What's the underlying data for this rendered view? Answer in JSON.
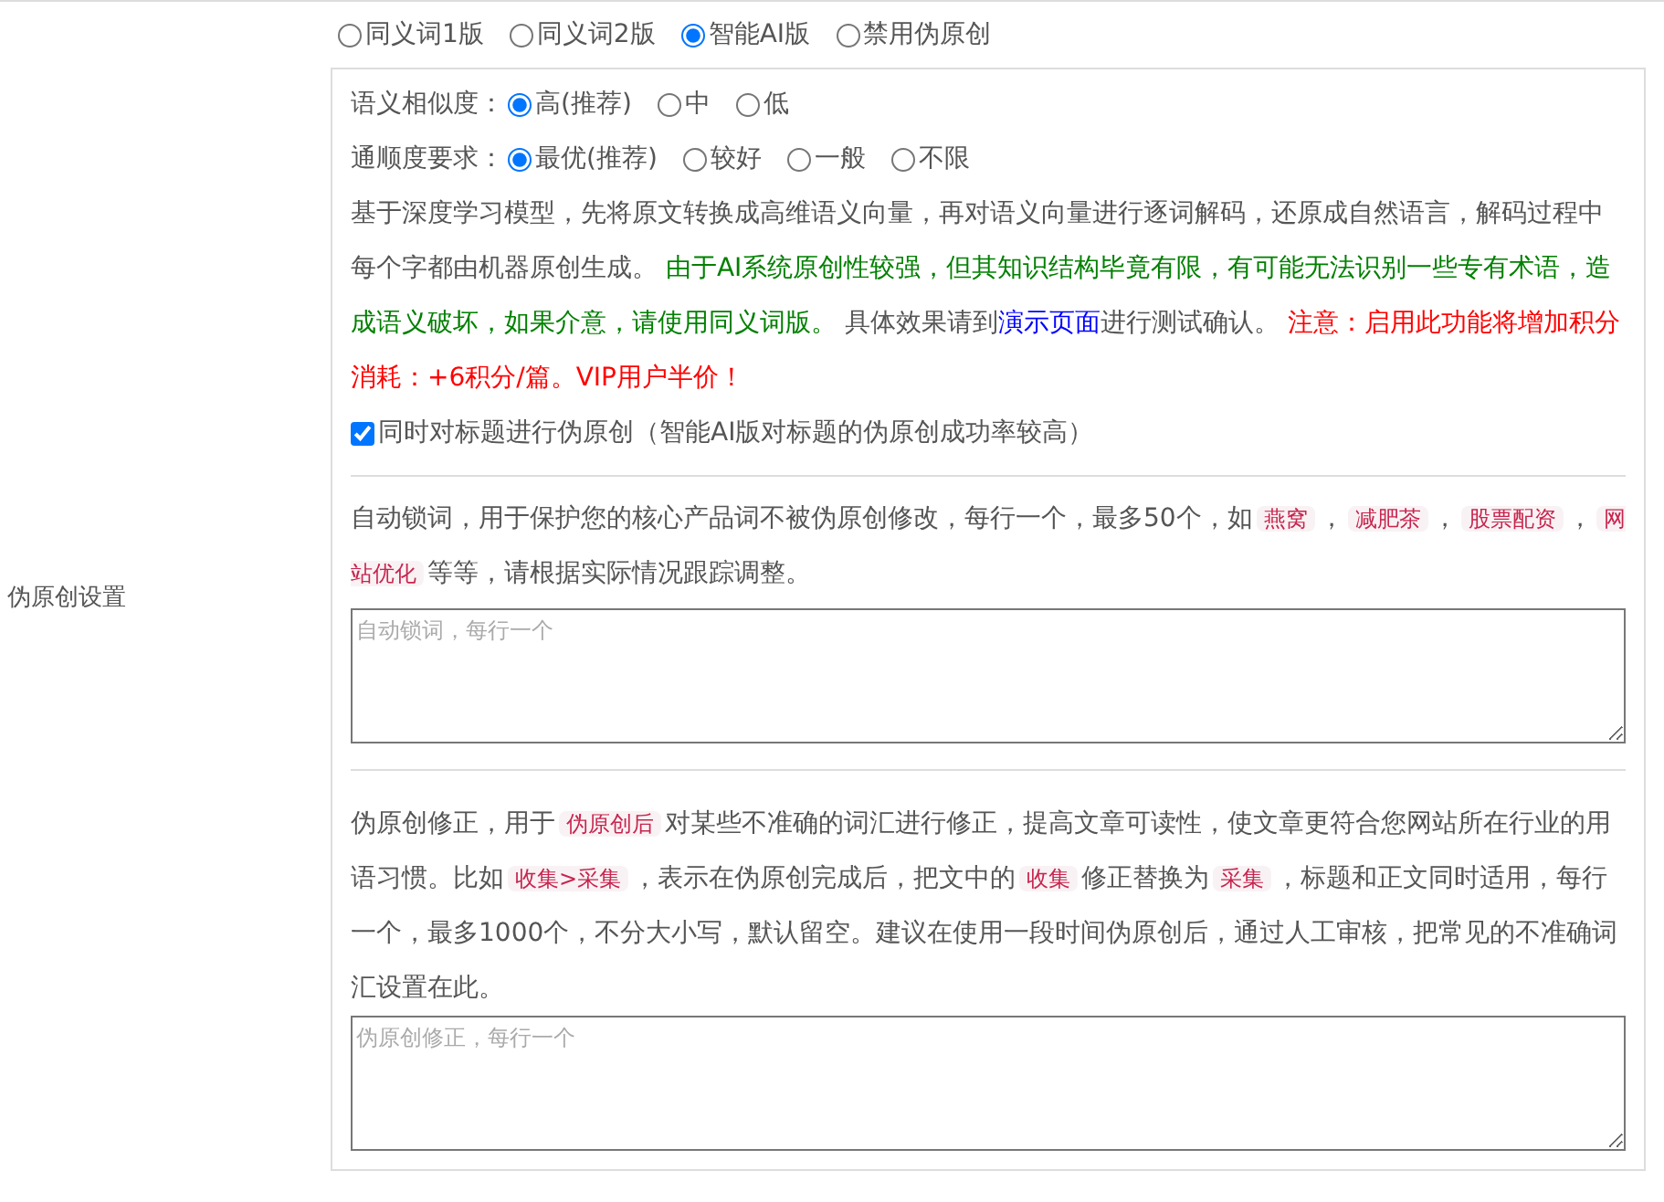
{
  "side_label": "伪原创设置",
  "modes": [
    {
      "label": "同义词1版",
      "selected": false
    },
    {
      "label": "同义词2版",
      "selected": false
    },
    {
      "label": "智能AI版",
      "selected": true
    },
    {
      "label": "禁用伪原创",
      "selected": false
    }
  ],
  "option_groups": [
    {
      "label": "语义相似度：",
      "options": [
        {
          "label": "高(推荐)",
          "selected": true
        },
        {
          "label": "中",
          "selected": false
        },
        {
          "label": "低",
          "selected": false
        }
      ]
    },
    {
      "label": "通顺度要求：",
      "options": [
        {
          "label": "最优(推荐)",
          "selected": true
        },
        {
          "label": "较好",
          "selected": false
        },
        {
          "label": "一般",
          "selected": false
        },
        {
          "label": "不限",
          "selected": false
        }
      ]
    }
  ],
  "ai_description": [
    {
      "kind": "plain",
      "text": "基于深度学习模型，先将原文转换成高维语义向量，再对语义向量进行逐词解码，还原成自然语言，解码过程中每个字都由机器原创生成。 "
    },
    {
      "kind": "green",
      "text": "由于AI系统原创性较强，但其知识结构毕竟有限，有可能无法识别一些专有术语，造成语义破坏，如果介意，请使用同义词版。"
    },
    {
      "kind": "plain",
      "text": " 具体效果请到"
    },
    {
      "kind": "link",
      "text": "演示页面"
    },
    {
      "kind": "plain",
      "text": "进行测试确认。 "
    },
    {
      "kind": "red",
      "text": "注意：启用此功能将增加积分消耗：+6积分/篇。VIP用户半价！"
    }
  ],
  "title_checkbox": {
    "label": "同时对标题进行伪原创（智能AI版对标题的伪原创成功率较高）",
    "checked": true
  },
  "lock_description": [
    {
      "kind": "plain",
      "text": "自动锁词，用于保护您的核心产品词不被伪原创修改，每行一个，最多50个，如"
    },
    {
      "kind": "code",
      "text": "燕窝"
    },
    {
      "kind": "plain",
      "text": "，"
    },
    {
      "kind": "code",
      "text": "减肥茶"
    },
    {
      "kind": "plain",
      "text": "，"
    },
    {
      "kind": "code",
      "text": "股票配资"
    },
    {
      "kind": "plain",
      "text": "，"
    },
    {
      "kind": "code",
      "text": "网站优化"
    },
    {
      "kind": "plain",
      "text": "等等，请根据实际情况跟踪调整。"
    }
  ],
  "lock_field": {
    "placeholder": "自动锁词，每行一个"
  },
  "fix_description": [
    {
      "kind": "plain",
      "text": "伪原创修正，用于"
    },
    {
      "kind": "code",
      "text": "伪原创后"
    },
    {
      "kind": "plain",
      "text": "对某些不准确的词汇进行修正，提高文章可读性，使文章更符合您网站所在行业的用语习惯。比如"
    },
    {
      "kind": "code",
      "text": "收集>采集"
    },
    {
      "kind": "plain",
      "text": "，表示在伪原创完成后，把文中的"
    },
    {
      "kind": "code",
      "text": "收集"
    },
    {
      "kind": "plain",
      "text": "修正替换为"
    },
    {
      "kind": "code",
      "text": "采集"
    },
    {
      "kind": "plain",
      "text": "，标题和正文同时适用，每行一个，最多1000个，不分大小写，默认留空。建议在使用一段时间伪原创后，通过人工审核，把常见的不准确词汇设置在此。"
    }
  ],
  "fix_field": {
    "placeholder": "伪原创修正，每行一个"
  }
}
